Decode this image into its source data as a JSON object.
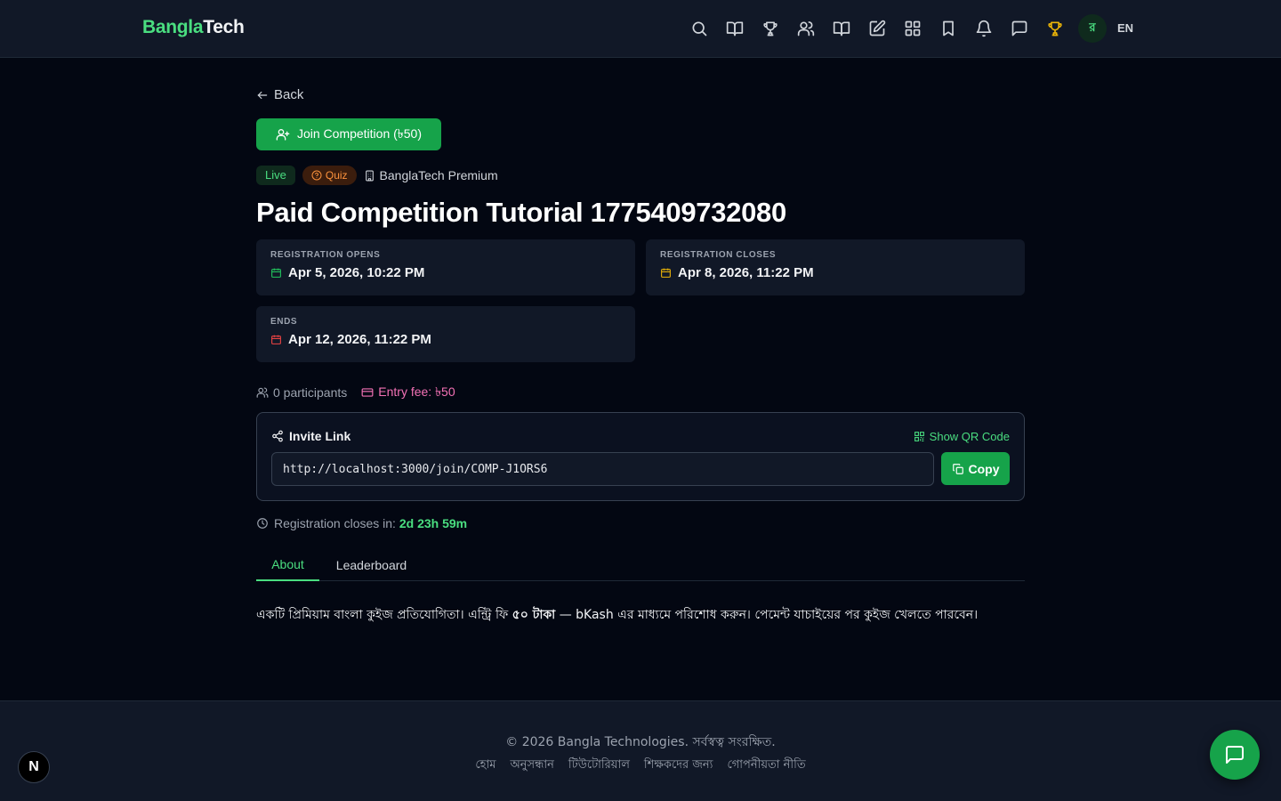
{
  "header": {
    "brand_part1": "Bangla",
    "brand_part2": "Tech",
    "avatar_initial": "র",
    "lang": "EN"
  },
  "page": {
    "back_label": "Back",
    "join_label": "Join Competition (৳50)",
    "badges": {
      "status": "Live",
      "type": "Quiz",
      "org": "BanglaTech Premium"
    },
    "title": "Paid Competition Tutorial 1775409732080"
  },
  "dates": [
    {
      "label": "Registration opens",
      "value": "Apr 5, 2026, 10:22 PM",
      "color": "#22c55e"
    },
    {
      "label": "Registration closes",
      "value": "Apr 8, 2026, 11:22 PM",
      "color": "#eab308"
    },
    {
      "label": "Ends",
      "value": "Apr 12, 2026, 11:22 PM",
      "color": "#ef4444"
    }
  ],
  "meta": {
    "participants": "0 participants",
    "entry_fee": "Entry fee: ৳50"
  },
  "invite": {
    "heading": "Invite Link",
    "qr_label": "Show QR Code",
    "url": "http://localhost:3000/join/COMP-J1ORS6",
    "copy_label": "Copy"
  },
  "countdown": {
    "label": "Registration closes in: ",
    "value": "2d 23h 59m"
  },
  "tabs": {
    "about": "About",
    "leaderboard": "Leaderboard"
  },
  "about": {
    "text_before": "একটি প্রিমিয়াম বাংলা কুইজ প্রতিযোগিতা। এন্ট্রি ফি ",
    "text_bold": "৫০ টাকা",
    "text_after": " — bKash এর মাধ্যমে পরিশোধ করুন। পেমেন্ট যাচাইয়ের পর কুইজ খেলতে পারবেন।"
  },
  "footer": {
    "copyright": "© 2026 Bangla Technologies. সর্বস্বত্ব সংরক্ষিত.",
    "links": [
      "হোম",
      "অনুসন্ধান",
      "টিউটোরিয়াল",
      "শিক্ষকদের জন্য",
      "গোপনীয়তা নীতি"
    ]
  },
  "colors": {
    "accent": "#16a34a",
    "accent_text": "#4ade80",
    "trophy_active": "#eab308",
    "fee": "#f472b6"
  }
}
